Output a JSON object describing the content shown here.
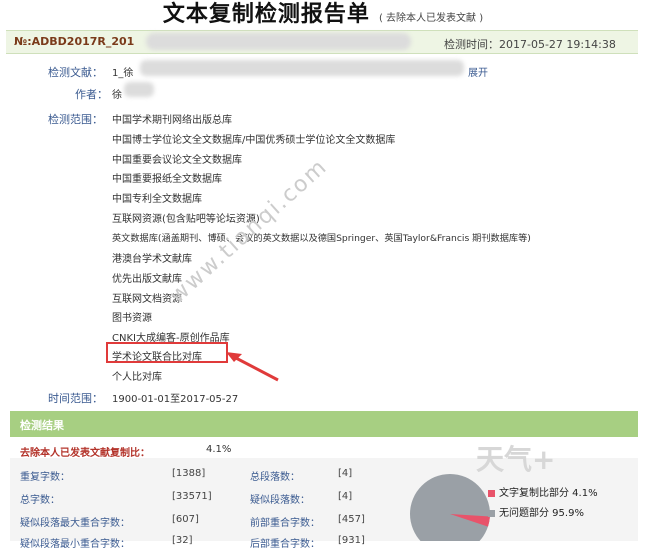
{
  "report": {
    "title": "文本复制检测报告单",
    "subtitle": "( 去除本人已发表文献 )",
    "number": "№:ADBD2017R_201",
    "check_time": "检测时间：2017-05-27 19:14:38"
  },
  "info": {
    "doc_label": "检测文献：",
    "doc_value_prefix": "1_徐",
    "doc_value_suffix": "展开",
    "author_label": "作者：",
    "author_value": "徐",
    "scope_label": "检测范围：",
    "scope_items": [
      "中国学术期刊网络出版总库",
      "中国博士学位论文全文数据库/中国优秀硕士学位论文全文数据库",
      "中国重要会议论文全文数据库",
      "中国重要报纸全文数据库",
      "中国专利全文数据库",
      "互联网资源(包含贴吧等论坛资源)",
      "英文数据库(涵盖期刊、博硕、会议的英文数据以及德国Springer、英国Taylor&Francis 期刊数据库等)",
      "港澳台学术文献库",
      "优先出版文献库",
      "互联网文档资源",
      "图书资源",
      "CNKI大成编客-原创作品库",
      "学术论文联合比对库",
      "个人比对库"
    ],
    "time_label": "时间范围：",
    "time_value": "1900-01-01至2017-05-27"
  },
  "watermark": "www.tianqi.com",
  "brand": "天气+",
  "results": {
    "header": "检测结果",
    "rate_label": "去除本人已发表文献复制比：",
    "rate_value": "4.1%",
    "stats": [
      {
        "label": "重复字数：",
        "value": "[1388]"
      },
      {
        "label": "总段落数：",
        "value": "[4]"
      },
      {
        "label": "总字数：",
        "value": "[33571]"
      },
      {
        "label": "疑似段落数：",
        "value": "[4]"
      },
      {
        "label": "疑似段落最大重合字数：",
        "value": "[607]"
      },
      {
        "label": "前部重合字数：",
        "value": "[457]"
      },
      {
        "label": "疑似段落最小重合字数：",
        "value": "[32]"
      },
      {
        "label": "后部重合字数：",
        "value": "[931]"
      }
    ],
    "legend": [
      {
        "label": "文字复制比部分 4.1%",
        "color": "#e8536a"
      },
      {
        "label": "无问题部分 95.9%",
        "color": "#9aa0a6"
      }
    ],
    "pie": {
      "copy_percent": 4.1,
      "ok_percent": 95.9
    }
  }
}
